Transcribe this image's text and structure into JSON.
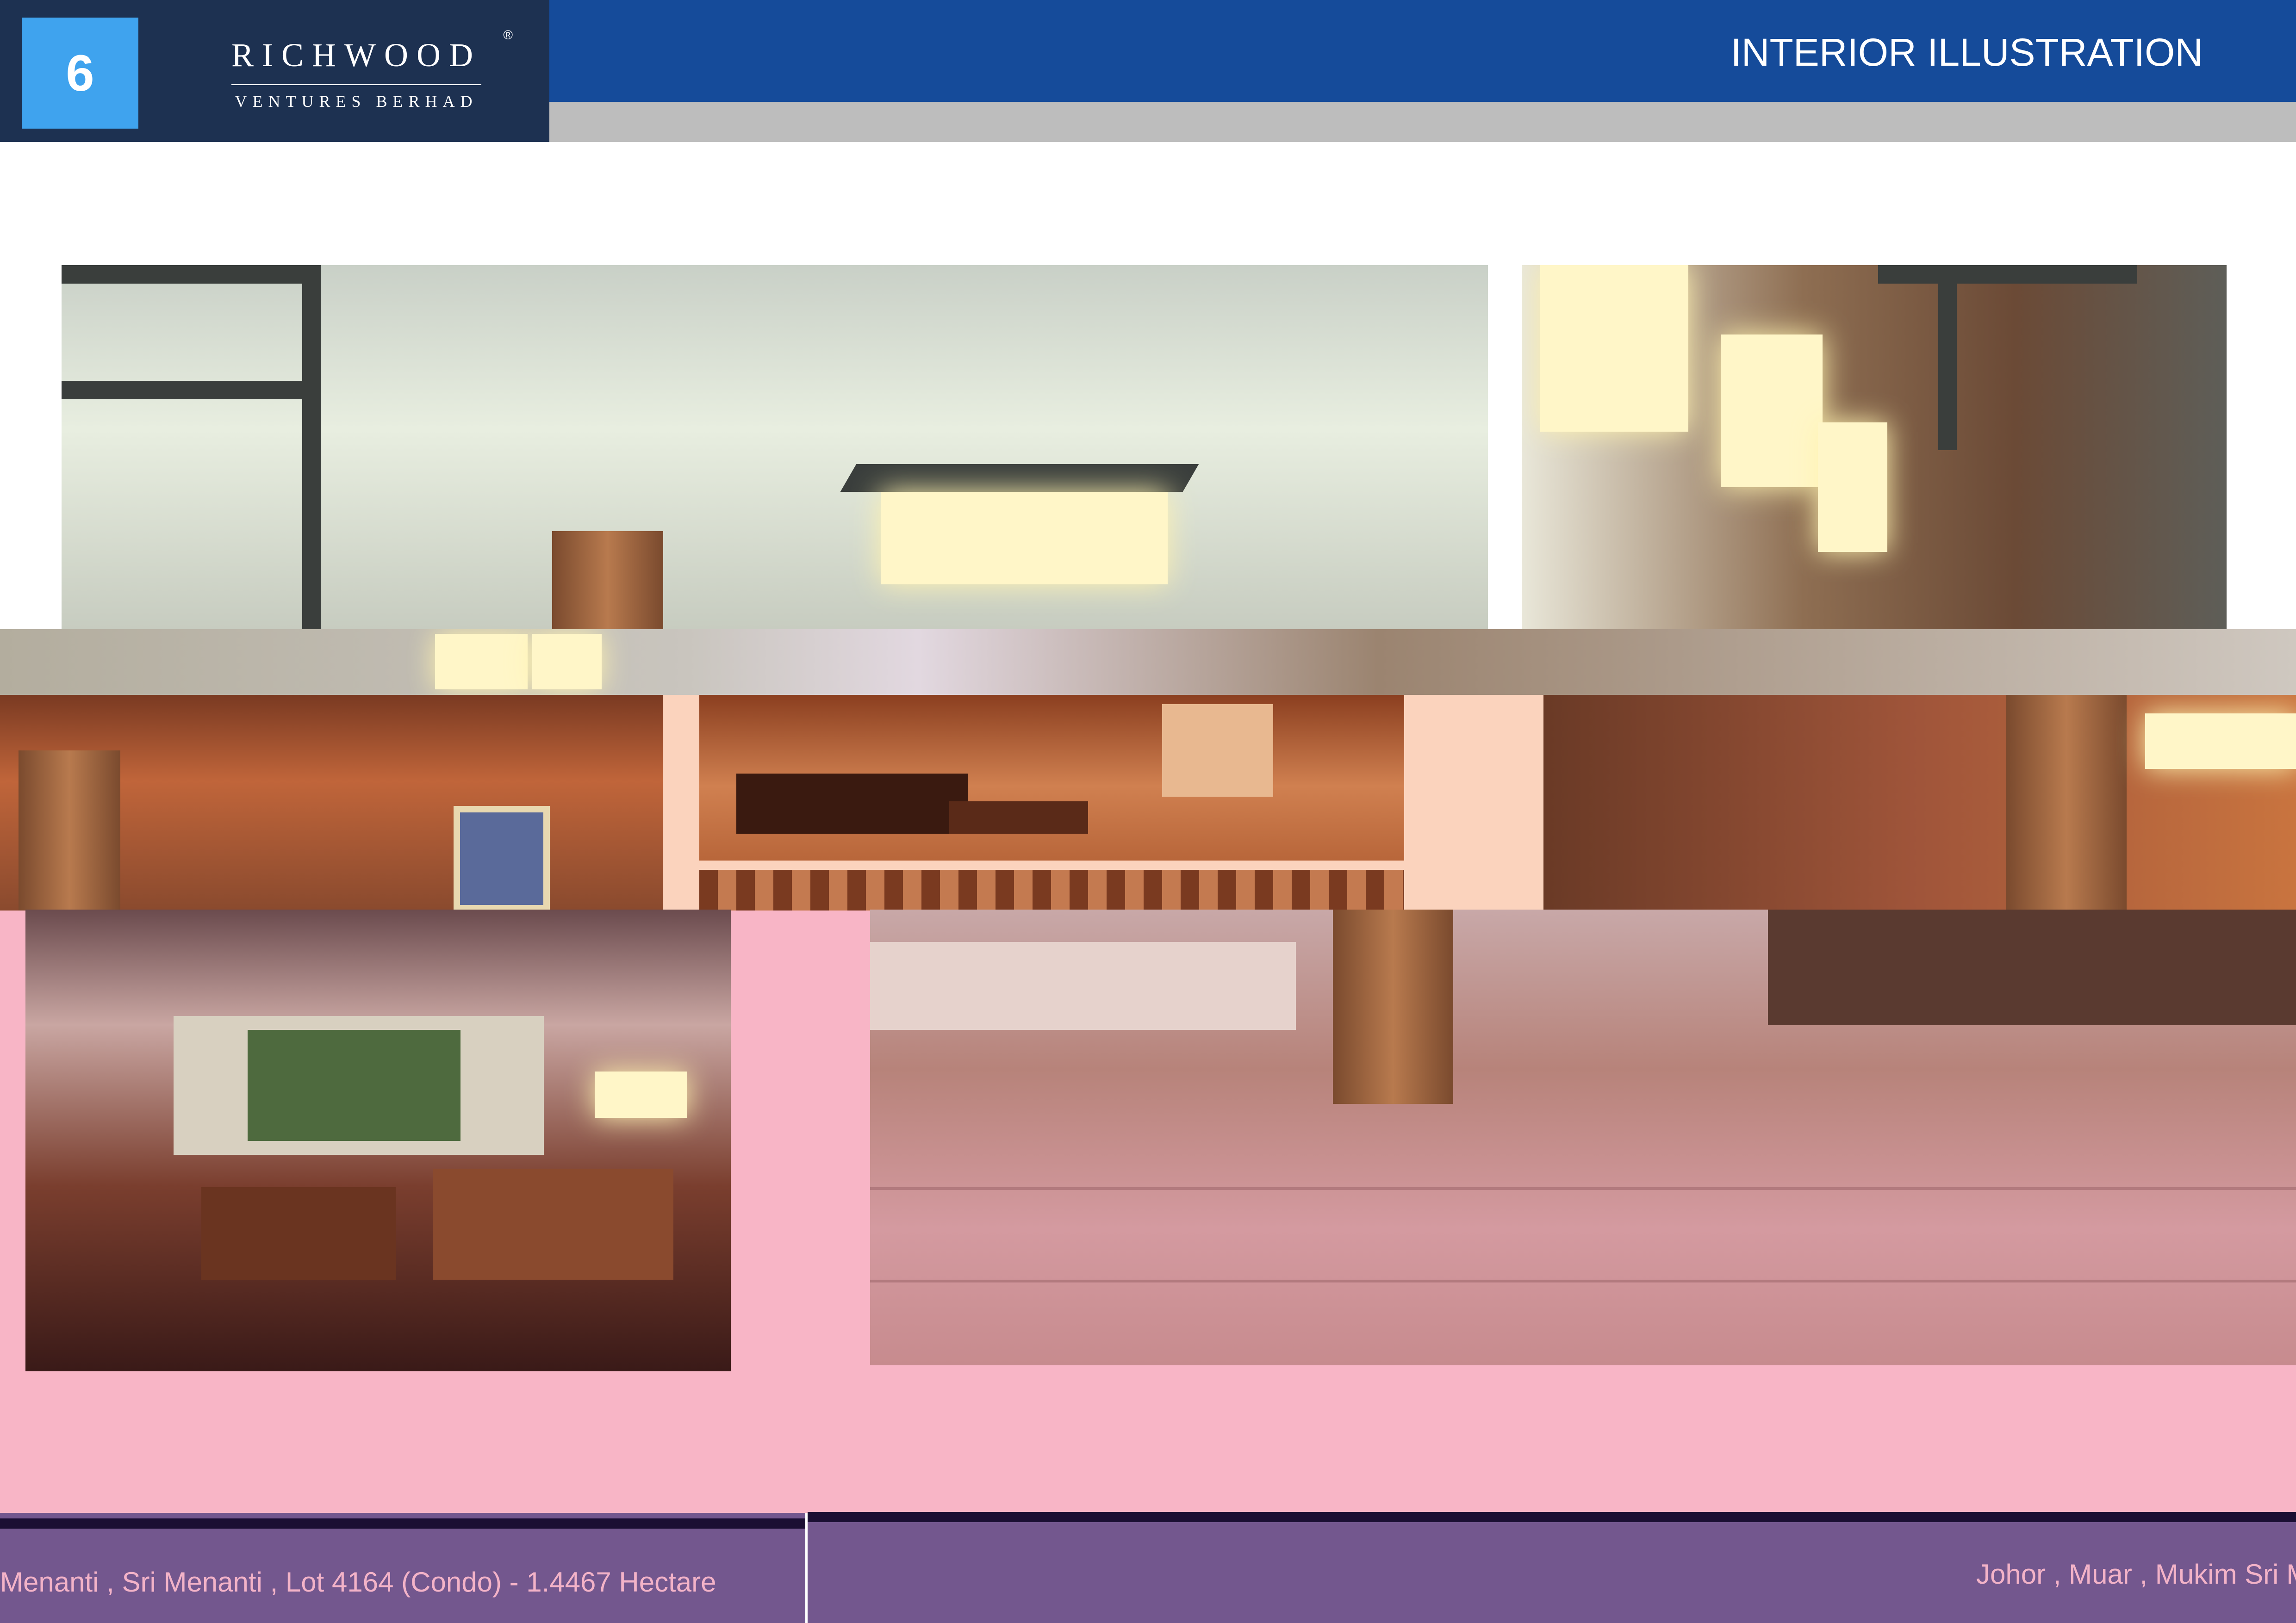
{
  "header": {
    "page_number": "6",
    "logo_name": "RICHWOOD",
    "logo_registered": "®",
    "logo_subtitle": "VENTURES BERHAD",
    "title": "INTERIOR ILLUSTRATION"
  },
  "footer": {
    "left_text": "Menanti , Sri Menanti , Lot 4164 (Condo) - 1.4467 Hectare",
    "right_text": "Johor , Muar , Mukim Sri M"
  },
  "colors": {
    "header_bar": "#154b9a",
    "brand_block": "#1d3151",
    "page_badge": "#3fa3ee",
    "footer_band": "#73578e",
    "footer_text": "#f3b3c8",
    "page_background_band": "#f8b5c6"
  }
}
